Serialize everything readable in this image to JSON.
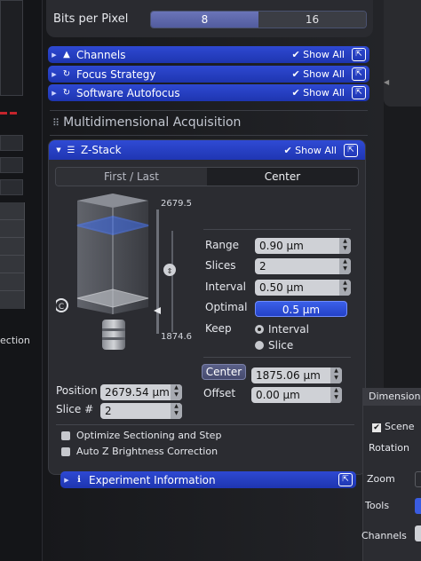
{
  "bits_per_pixel": {
    "label": "Bits per Pixel",
    "options": [
      "8",
      "16"
    ],
    "selected": "8"
  },
  "bars": [
    {
      "label": "Channels",
      "icon": "channels-icon",
      "show_all": "Show All"
    },
    {
      "label": "Focus Strategy",
      "icon": "focus-strategy-icon",
      "show_all": "Show All"
    },
    {
      "label": "Software Autofocus",
      "icon": "software-autofocus-icon",
      "show_all": "Show All"
    }
  ],
  "section_title": "Multidimensional Acquisition",
  "zstack": {
    "title": "Z-Stack",
    "show_all": "Show All",
    "tabs": [
      "First / Last",
      "Center"
    ],
    "active_tab": "Center",
    "top_value": "2679.5",
    "bottom_value": "1874.6",
    "range_label": "Range",
    "range_value": "0.90 µm",
    "slices_label": "Slices",
    "slices_value": "2",
    "interval_label": "Interval",
    "interval_value": "0.50 µm",
    "optimal_label": "Optimal",
    "optimal_value": "0.5 µm",
    "keep_label": "Keep",
    "keep_interval": "Interval",
    "keep_slice": "Slice",
    "keep_selected": "Interval",
    "center_button": "Center",
    "center_value": "1875.06 µm",
    "offset_label": "Offset",
    "offset_value": "0.00 µm",
    "position_label": "Position",
    "position_value": "2679.54 µm",
    "slice_num_label": "Slice #",
    "slice_num_value": "2",
    "opt_sectioning": "Optimize Sectioning and Step",
    "auto_z": "Auto Z Brightness Correction"
  },
  "experiment_info": {
    "label": "Experiment Information"
  },
  "left_window": {
    "partial_text": "ection"
  },
  "dimensions": {
    "title": "Dimensions",
    "scene": "Scene",
    "rotation": "Rotation",
    "zoom": "Zoom",
    "tools": "Tools",
    "channels": "Channels"
  },
  "colors": {
    "accent_blue": "#2440c4",
    "highlight_blue": "#3a6bff"
  }
}
